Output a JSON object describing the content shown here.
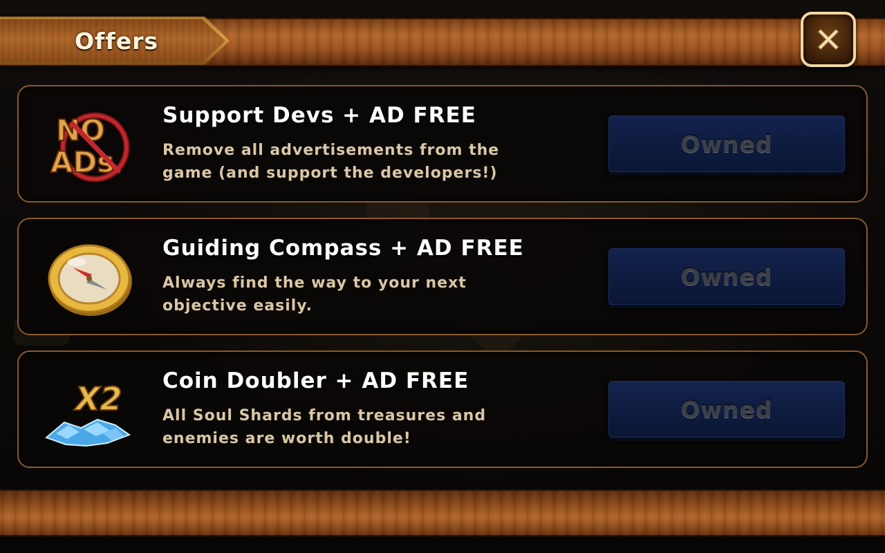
{
  "header": {
    "title": "Offers",
    "close_icon": "close-x-icon"
  },
  "offers": [
    {
      "icon": "no-ads-icon",
      "icon_text_top": "NO",
      "icon_text_bottom": "ADs",
      "title": "Support Devs + AD FREE",
      "description": "Remove all advertisements from the game (and support the developers!)",
      "button_label": "Owned"
    },
    {
      "icon": "compass-icon",
      "title": "Guiding Compass + AD FREE",
      "description": "Always find the way to your next objective easily.",
      "button_label": "Owned"
    },
    {
      "icon": "soul-shards-x2-icon",
      "icon_text": "X2",
      "title": "Coin Doubler + AD FREE",
      "description": "All Soul Shards from treasures and enemies are worth double!",
      "button_label": "Owned"
    }
  ],
  "colors": {
    "wood": "#b2662b",
    "gold": "#d7a24e",
    "card_border": "#8a5a2a",
    "button_blue": "#14234e",
    "button_text": "#3b3f48"
  }
}
